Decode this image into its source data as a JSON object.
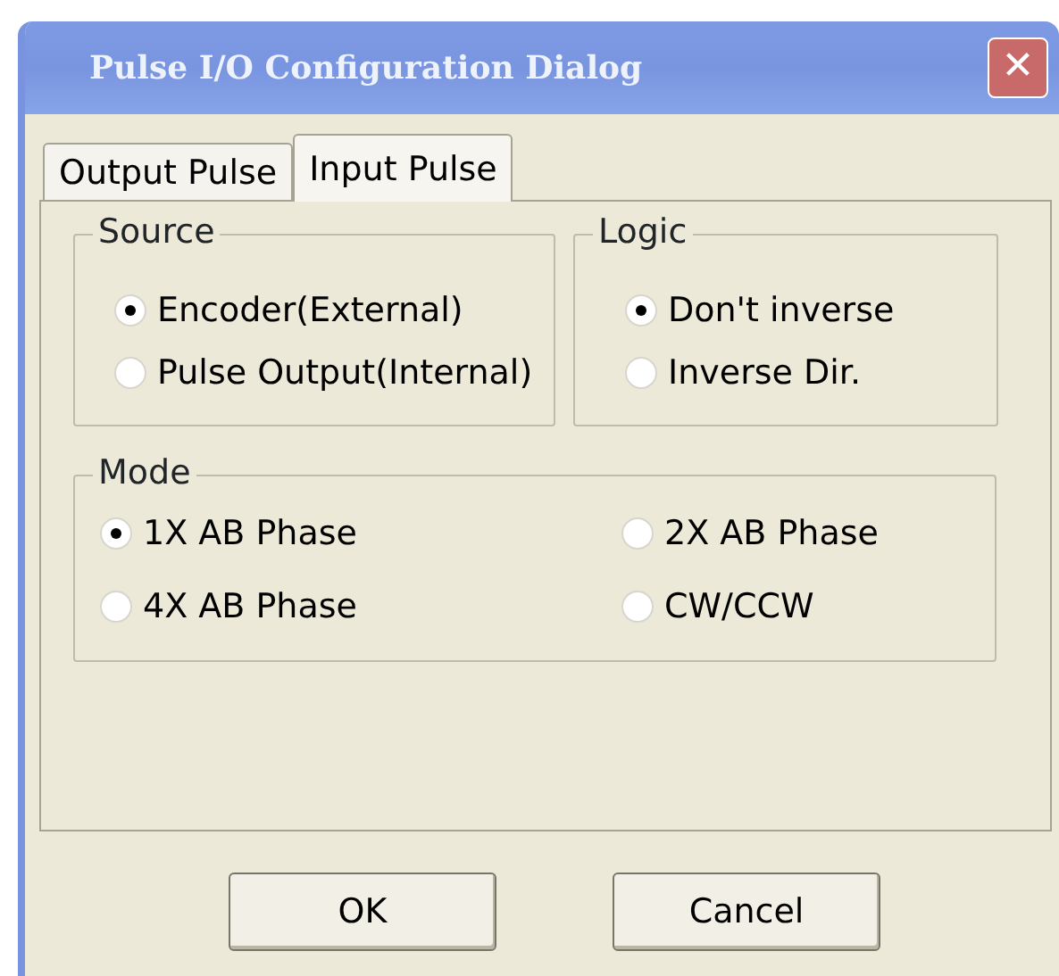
{
  "window": {
    "title": "Pulse I/O Configuration Dialog",
    "close": "✕"
  },
  "tabs": [
    {
      "label": "Output Pulse",
      "selected": false
    },
    {
      "label": "Input Pulse",
      "selected": true
    }
  ],
  "groups": [
    {
      "title": "Source",
      "options": [
        {
          "label": "Encoder(External)",
          "selected": true
        },
        {
          "label": "Pulse Output(Internal)",
          "selected": false
        }
      ]
    },
    {
      "title": "Logic",
      "options": [
        {
          "label": "Don't inverse",
          "selected": true
        },
        {
          "label": "Inverse Dir.",
          "selected": false
        }
      ]
    },
    {
      "title": "Mode",
      "options": [
        {
          "label": "1X AB Phase",
          "selected": true
        },
        {
          "label": "2X AB Phase",
          "selected": false
        },
        {
          "label": "4X AB Phase",
          "selected": false
        },
        {
          "label": "CW/CCW",
          "selected": false
        }
      ]
    }
  ],
  "buttons": [
    "OK",
    "Cancel"
  ]
}
